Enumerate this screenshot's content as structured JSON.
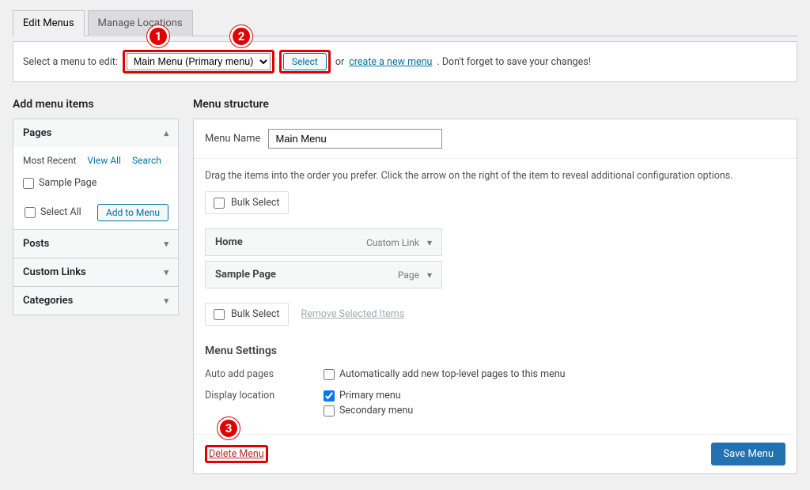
{
  "tabs": {
    "edit": "Edit Menus",
    "manage": "Manage Locations"
  },
  "select_bar": {
    "label": "Select a menu to edit:",
    "dropdown_value": "Main Menu (Primary menu)",
    "select_btn": "Select",
    "or": "or",
    "create_link": "create a new menu",
    "tail": ". Don't forget to save your changes!"
  },
  "annotations": {
    "n1": "1",
    "n2": "2",
    "n3": "3"
  },
  "left": {
    "title": "Add menu items",
    "pages": {
      "head": "Pages",
      "subtabs": {
        "recent": "Most Recent",
        "viewall": "View All",
        "search": "Search"
      },
      "item": "Sample Page",
      "select_all": "Select All",
      "add_btn": "Add to Menu"
    },
    "posts": "Posts",
    "custom_links": "Custom Links",
    "categories": "Categories"
  },
  "right": {
    "title": "Menu structure",
    "name_label": "Menu Name",
    "name_value": "Main Menu",
    "hint": "Drag the items into the order you prefer. Click the arrow on the right of the item to reveal additional configuration options.",
    "bulk_select": "Bulk Select",
    "items": [
      {
        "label": "Home",
        "type": "Custom Link"
      },
      {
        "label": "Sample Page",
        "type": "Page"
      }
    ],
    "remove_selected": "Remove Selected Items",
    "settings_head": "Menu Settings",
    "auto_add_label": "Auto add pages",
    "auto_add_text": "Automatically add new top-level pages to this menu",
    "display_label": "Display location",
    "loc_primary": "Primary menu",
    "loc_secondary": "Secondary menu",
    "delete": "Delete Menu",
    "save": "Save Menu"
  }
}
